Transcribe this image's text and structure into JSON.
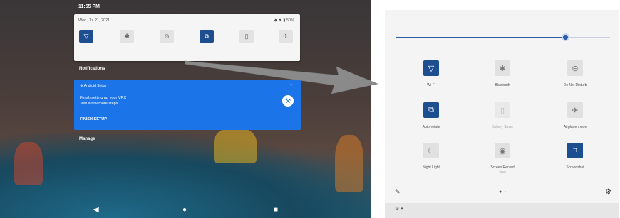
{
  "left": {
    "status_time": "11:55 PM",
    "qs": {
      "date": "Wed, Jul 21, 2021",
      "status": "◆ ▼ ▮ 50%",
      "tiles": [
        {
          "icon": "wifi-icon",
          "glyph": "▽",
          "state": "on"
        },
        {
          "icon": "bluetooth-icon",
          "glyph": "✱",
          "state": "off"
        },
        {
          "icon": "do-not-disturb-icon",
          "glyph": "⊝",
          "state": "off"
        },
        {
          "icon": "auto-rotate-icon",
          "glyph": "⧉",
          "state": "on"
        },
        {
          "icon": "battery-saver-icon",
          "glyph": "▯",
          "state": "off"
        },
        {
          "icon": "airplane-icon",
          "glyph": "✈",
          "state": "off"
        }
      ]
    },
    "notifications_label": "Notifications",
    "card": {
      "app": "Android Setup",
      "title": "Finish setting up your VRX",
      "subtitle": "Just a few more steps",
      "action": "FINISH SETUP"
    },
    "manage_label": "Manage",
    "nav": {
      "back": "◀",
      "home": "●",
      "recents": "■"
    }
  },
  "right": {
    "brightness_level": 0.79,
    "tiles": [
      {
        "name": "wifi",
        "label": "Wi-Fi",
        "icon": "wifi-icon",
        "glyph": "▽",
        "state": "on",
        "sub": ""
      },
      {
        "name": "bluetooth",
        "label": "Bluetooth",
        "icon": "bluetooth-icon",
        "glyph": "✱",
        "state": "off",
        "sub": ""
      },
      {
        "name": "do-not-disturb",
        "label": "Do Not Disturb",
        "icon": "do-not-disturb-icon",
        "glyph": "⊝",
        "state": "off",
        "sub": ""
      },
      {
        "name": "auto-rotate",
        "label": "Auto-rotate",
        "icon": "auto-rotate-icon",
        "glyph": "⧉",
        "state": "on",
        "sub": ""
      },
      {
        "name": "battery-saver",
        "label": "Battery Saver",
        "icon": "battery-saver-icon",
        "glyph": "▯",
        "state": "dim",
        "sub": ""
      },
      {
        "name": "airplane-mode",
        "label": "Airplane mode",
        "icon": "airplane-icon",
        "glyph": "✈",
        "state": "off",
        "sub": ""
      },
      {
        "name": "night-light",
        "label": "Night Light",
        "icon": "night-light-icon",
        "glyph": "☾",
        "state": "off",
        "sub": ""
      },
      {
        "name": "screen-record",
        "label": "Screen Record",
        "icon": "screen-record-icon",
        "glyph": "◉",
        "state": "off",
        "sub": "Start"
      },
      {
        "name": "screenshot",
        "label": "Screenshot",
        "icon": "screenshot-icon",
        "glyph": "⌗",
        "state": "on",
        "sub": ""
      }
    ],
    "edit_glyph": "✎",
    "page_dots": "● ·",
    "settings_glyph": "⚙",
    "bottom_glyph": "⚙ ▾"
  }
}
